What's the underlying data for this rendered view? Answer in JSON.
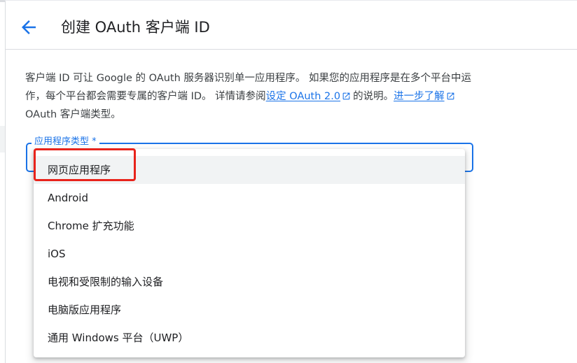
{
  "header": {
    "back_icon": "arrow-back-icon",
    "title": "创建 OAuth 客户端 ID"
  },
  "description": {
    "text_1": "客户端 ID 可让 Google 的 OAuth 服务器识别单一应用程序。 如果您的应用程序是在多个平台中运作，每个平台都会需要专属的客户端 ID。 详情请参阅",
    "link_1": "设定 OAuth 2.0",
    "text_2": "的说明。",
    "link_2": "进一步了解",
    "text_3": "OAuth 客户端类型。",
    "link_icon": "open-in-new-icon"
  },
  "form": {
    "app_type_label": "应用程序类型 *",
    "options": [
      {
        "label": "网页应用程序",
        "selected": true
      },
      {
        "label": "Android",
        "selected": false
      },
      {
        "label": "Chrome 扩充功能",
        "selected": false
      },
      {
        "label": "iOS",
        "selected": false
      },
      {
        "label": "电视和受限制的输入设备",
        "selected": false
      },
      {
        "label": "电脑版应用程序",
        "selected": false
      },
      {
        "label": "通用 Windows 平台（UWP）",
        "selected": false
      }
    ]
  },
  "colors": {
    "accent": "#1a73e8",
    "highlight": "#e8231b",
    "selected_bg": "#f1f3f4"
  }
}
